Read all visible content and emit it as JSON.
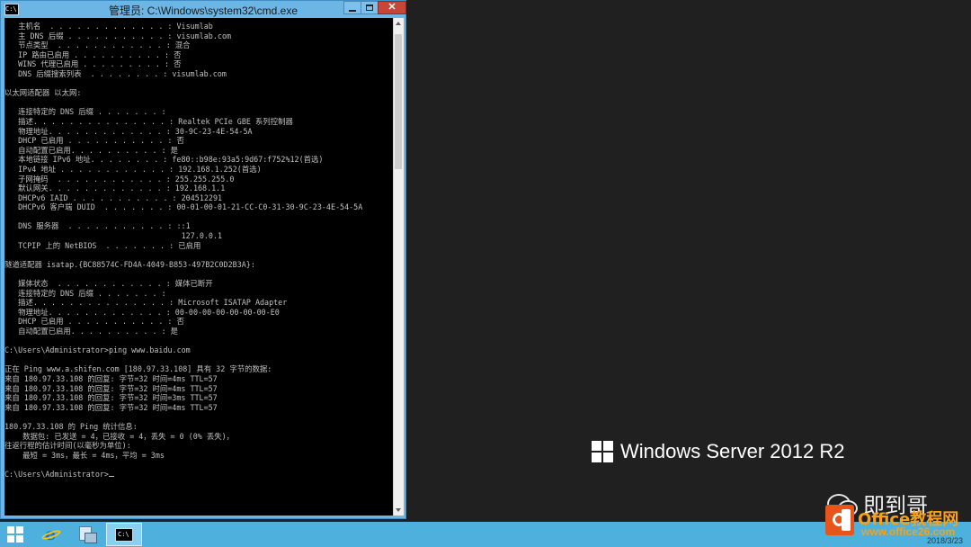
{
  "window": {
    "title": "管理员: C:\\Windows\\system32\\cmd.exe",
    "app_icon": "cmd-icon",
    "controls": [
      "minimize-icon",
      "maximize-icon",
      "close-icon"
    ]
  },
  "console": {
    "lines": [
      "   主机名  . . . . . . . . . . . . . : Visumlab",
      "   主 DNS 后缀 . . . . . . . . . . . : visumlab.com",
      "   节点类型  . . . . . . . . . . . . : 混合",
      "   IP 路由已启用 . . . . . . . . . . : 否",
      "   WINS 代理已启用 . . . . . . . . . : 否",
      "   DNS 后缀搜索列表  . . . . . . . . : visumlab.com",
      "",
      "以太网适配器 以太网:",
      "",
      "   连接特定的 DNS 后缀 . . . . . . . :",
      "   描述. . . . . . . . . . . . . . . : Realtek PCIe GBE 系列控制器",
      "   物理地址. . . . . . . . . . . . . : 30-9C-23-4E-54-5A",
      "   DHCP 已启用 . . . . . . . . . . . : 否",
      "   自动配置已启用. . . . . . . . . . : 是",
      "   本地链接 IPv6 地址. . . . . . . . : fe80::b98e:93a5:9d67:f752%12(首选)",
      "   IPv4 地址 . . . . . . . . . . . . : 192.168.1.252(首选)",
      "   子网掩码  . . . . . . . . . . . . : 255.255.255.0",
      "   默认网关. . . . . . . . . . . . . : 192.168.1.1",
      "   DHCPv6 IAID . . . . . . . . . . . : 204512291",
      "   DHCPv6 客户端 DUID  . . . . . . . : 00-01-00-01-21-CC-C0-31-30-9C-23-4E-54-5A",
      "",
      "   DNS 服务器  . . . . . . . . . . . : ::1",
      "                                       127.0.0.1",
      "   TCPIP 上的 NetBIOS  . . . . . . . : 已启用",
      "",
      "隧道适配器 isatap.{BC88574C-FD4A-4049-B853-497B2C0D2B3A}:",
      "",
      "   媒体状态  . . . . . . . . . . . . : 媒体已断开",
      "   连接特定的 DNS 后缀 . . . . . . . :",
      "   描述. . . . . . . . . . . . . . . : Microsoft ISATAP Adapter",
      "   物理地址. . . . . . . . . . . . . : 00-00-00-00-00-00-00-E0",
      "   DHCP 已启用 . . . . . . . . . . . : 否",
      "   自动配置已启用. . . . . . . . . . : 是",
      "",
      "C:\\Users\\Administrator>ping www.baidu.com",
      "",
      "正在 Ping www.a.shifen.com [180.97.33.108] 具有 32 字节的数据:",
      "来自 180.97.33.108 的回复: 字节=32 时间=4ms TTL=57",
      "来自 180.97.33.108 的回复: 字节=32 时间=4ms TTL=57",
      "来自 180.97.33.108 的回复: 字节=32 时间=3ms TTL=57",
      "来自 180.97.33.108 的回复: 字节=32 时间=4ms TTL=57",
      "",
      "180.97.33.108 的 Ping 统计信息:",
      "    数据包: 已发送 = 4，已接收 = 4，丢失 = 0 (0% 丢失)，",
      "往返行程的估计时间(以毫秒为单位):",
      "    最短 = 3ms，最长 = 4ms，平均 = 3ms",
      "",
      "C:\\Users\\Administrator>"
    ]
  },
  "desktop": {
    "branding": "Windows Server 2012 R2",
    "wechat_name": "即到哥"
  },
  "taskbar": {
    "items": [
      "start-icon",
      "internet-explorer-icon",
      "server-manager-icon",
      "cmd-icon"
    ]
  },
  "watermark": {
    "title": "Office教程网",
    "url": "www.office26.com"
  },
  "clock": {
    "date": "2018/3/23"
  },
  "colors": {
    "titlebar": "#6cb6e6",
    "console_bg": "#000000",
    "console_text": "#c0c0c0",
    "taskbar": "#4db0dd",
    "desktop": "#202020",
    "close_button": "#c7463a",
    "watermark": "#f6a219"
  }
}
